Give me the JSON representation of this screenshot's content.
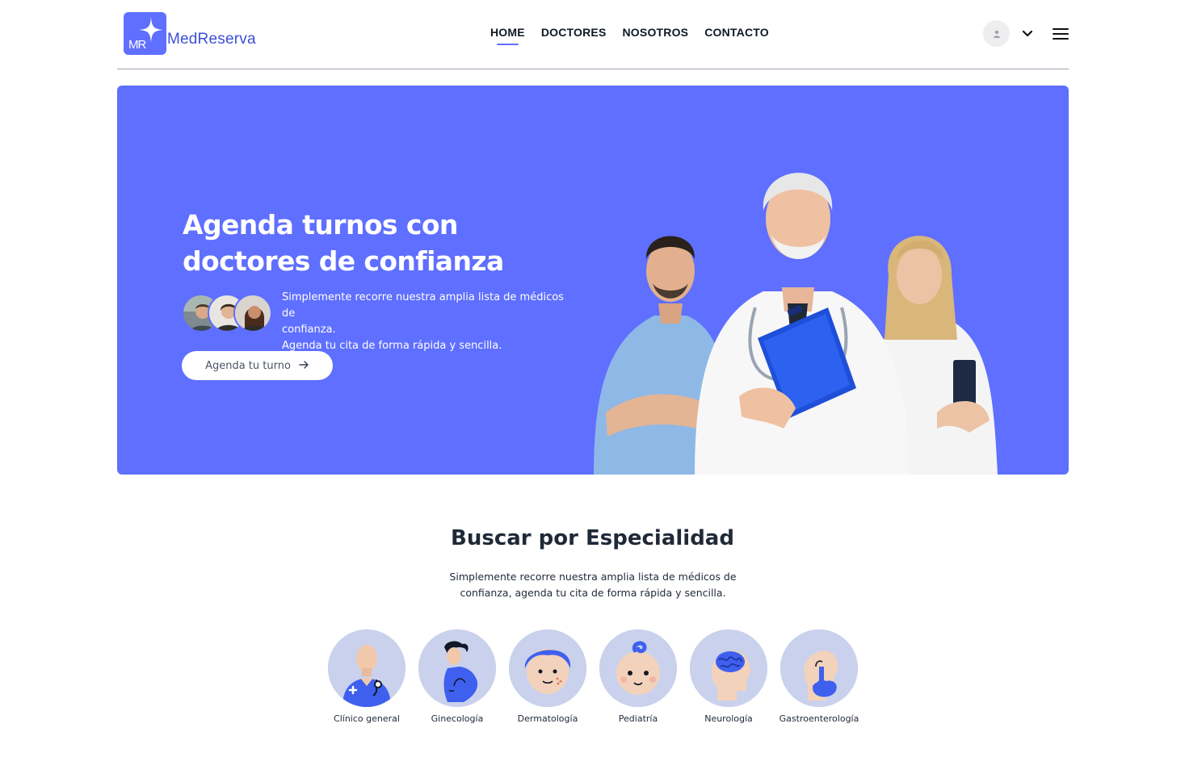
{
  "brand": {
    "logo_initials": "MR",
    "name": "MedReserva",
    "accent_color": "#5f6fff"
  },
  "nav": {
    "items": [
      {
        "label": "HOME",
        "active": true
      },
      {
        "label": "DOCTORES",
        "active": false
      },
      {
        "label": "NOSOTROS",
        "active": false
      },
      {
        "label": "CONTACTO",
        "active": false
      }
    ]
  },
  "user_menu": {
    "avatar_icon": "user-icon",
    "dropdown_icon": "chevron-down-icon",
    "menu_icon": "hamburger-menu-icon"
  },
  "hero": {
    "title_line1": "Agenda turnos con",
    "title_line2": "doctores de confianza",
    "text_line1": "Simplemente recorre nuestra amplia lista de médicos de",
    "text_line2": "confianza.",
    "text_line3": "Agenda tu cita de forma rápida y sencilla.",
    "button_label": "Agenda tu turno",
    "button_icon": "arrow-right-icon",
    "background_color": "#5f6fff"
  },
  "specialities": {
    "title": "Buscar por Especialidad",
    "desc_line1": "Simplemente recorre nuestra amplia lista de médicos de",
    "desc_line2": "confianza, agenda tu cita de forma rápida y sencilla.",
    "items": [
      {
        "label": "Clínico general",
        "icon": "general-physician-icon"
      },
      {
        "label": "Ginecología",
        "icon": "gynecology-icon"
      },
      {
        "label": "Dermatología",
        "icon": "dermatology-icon"
      },
      {
        "label": "Pediatría",
        "icon": "pediatrics-icon"
      },
      {
        "label": "Neurología",
        "icon": "neurology-icon"
      },
      {
        "label": "Gastroenterología",
        "icon": "gastroenterology-icon"
      }
    ]
  }
}
